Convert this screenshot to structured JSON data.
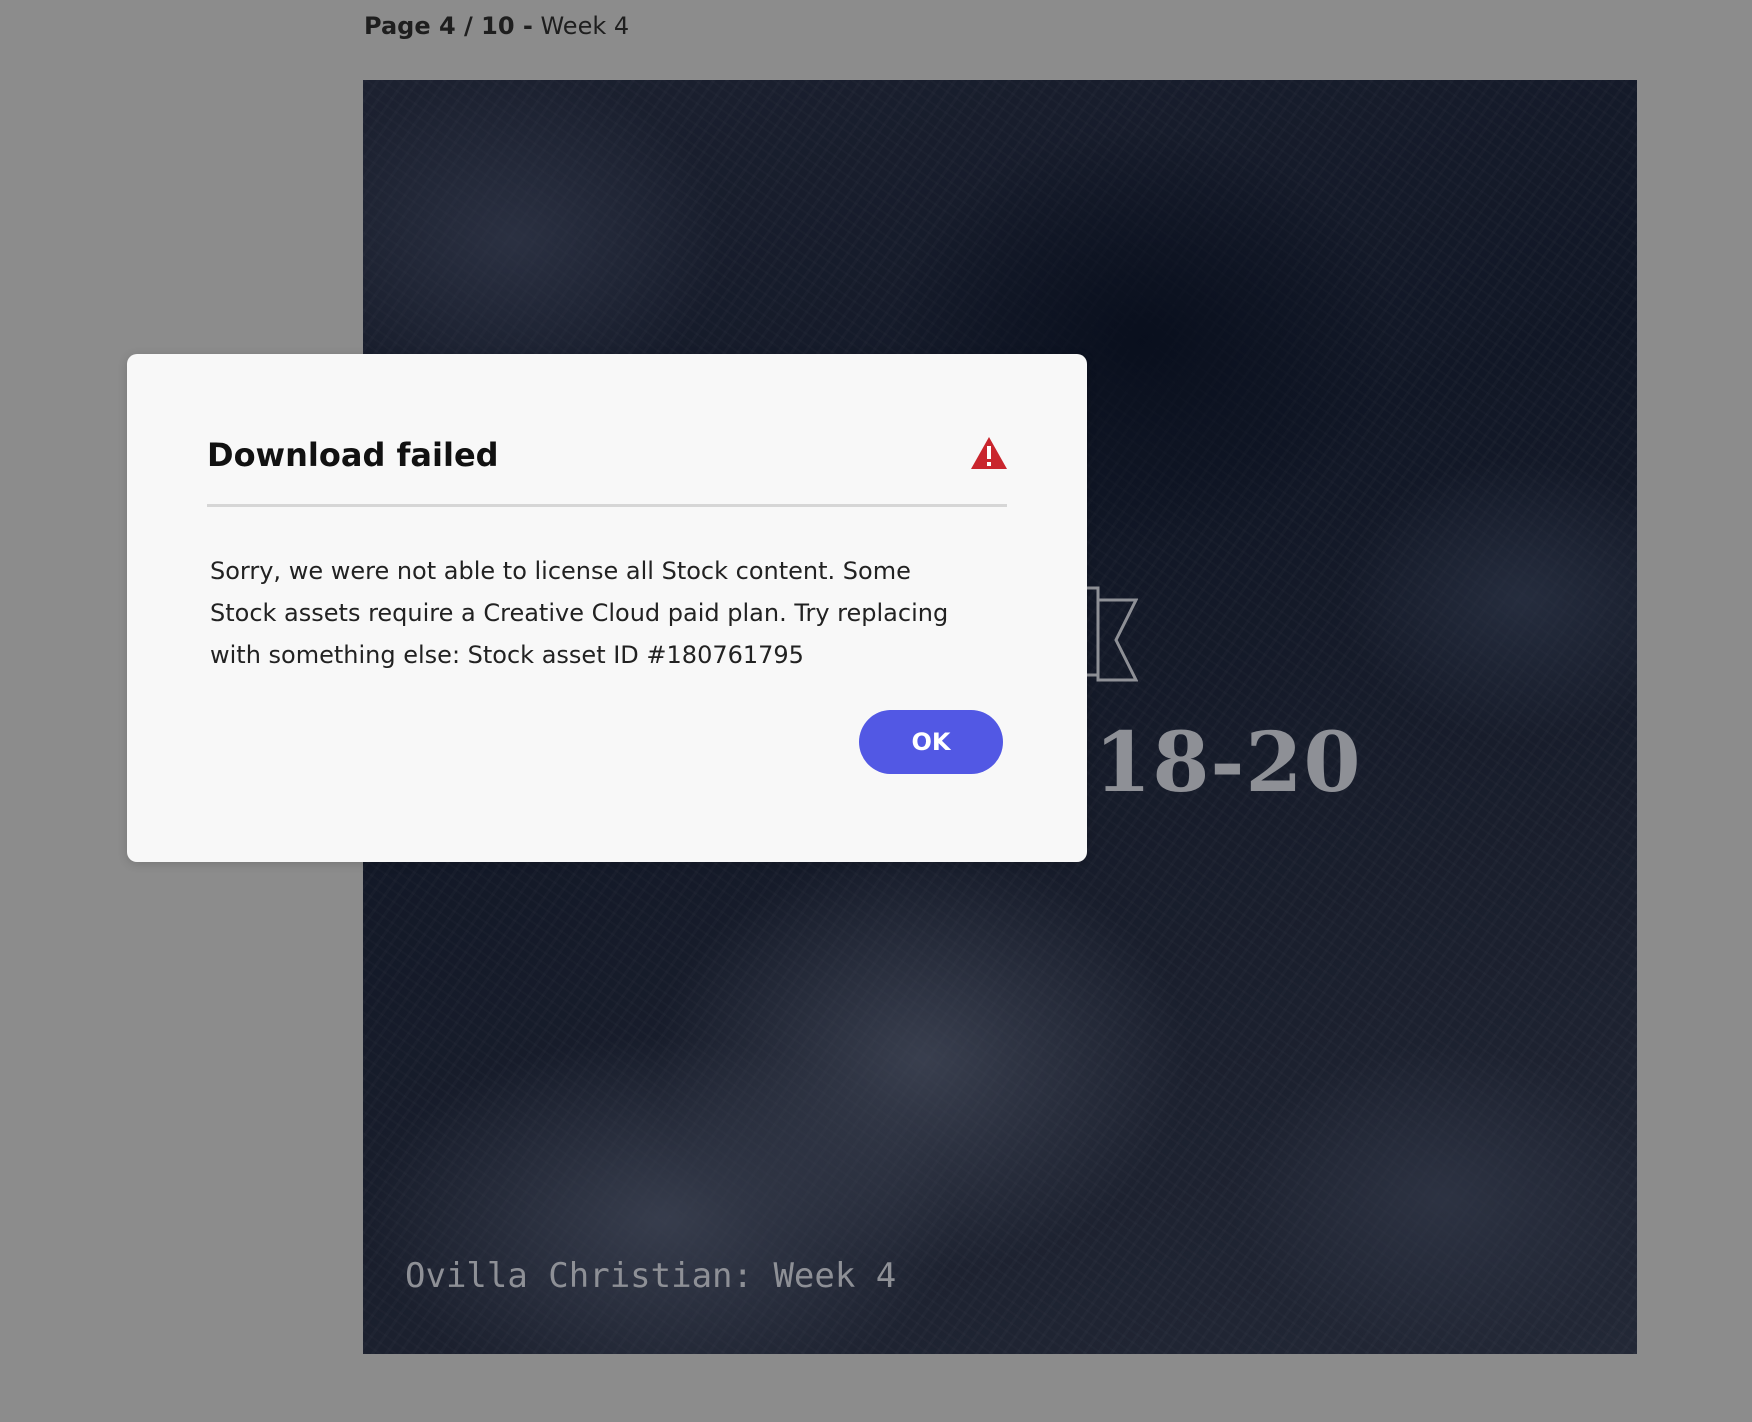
{
  "header": {
    "page_label": "Page 4 / 10 -",
    "page_name": "Week 4"
  },
  "document": {
    "verse_fragment": ":18-20",
    "footer_text": "Ovilla Christian: Week 4",
    "icon": "flag-icon"
  },
  "dialog": {
    "title": "Download failed",
    "icon": "warning-icon",
    "message": "Sorry, we were not able to license all Stock content. Some Stock assets require a Creative Cloud paid plan. Try replacing with something else: Stock asset ID #180761795",
    "ok_label": "OK"
  },
  "colors": {
    "background": "#8c8c8c",
    "dialog_background": "#f8f8f8",
    "primary_button": "#5258e4",
    "warning": "#c9252d"
  }
}
